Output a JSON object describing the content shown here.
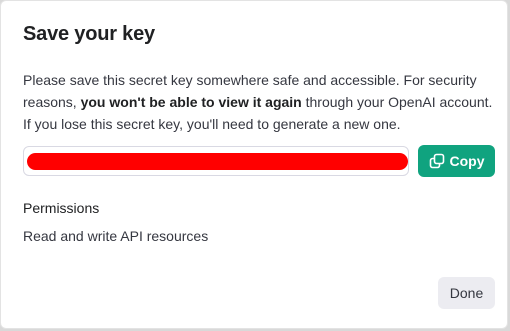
{
  "dialog": {
    "title": "Save your key",
    "description": {
      "before": "Please save this secret key somewhere safe and accessible. For security reasons, ",
      "emphasis": "you won't be able to view it again",
      "after": " through your OpenAI account. If you lose this secret key, you'll need to generate a new one."
    },
    "key_field": {
      "redaction_color": "#ff0000"
    },
    "copy_button": {
      "label": "Copy",
      "icon": "copy-icon",
      "color": "#10a37f"
    },
    "permissions": {
      "heading": "Permissions",
      "value": "Read and write API resources"
    },
    "done_button": {
      "label": "Done"
    }
  }
}
